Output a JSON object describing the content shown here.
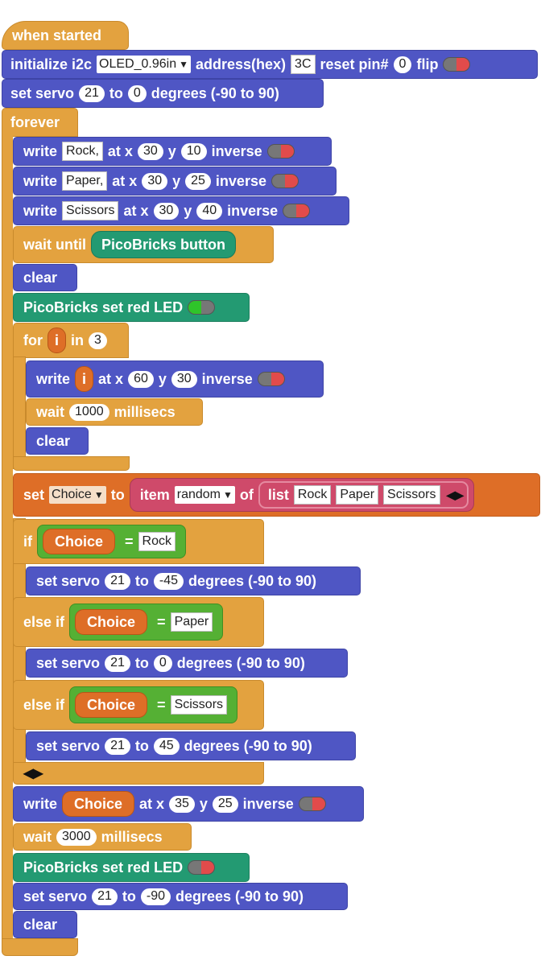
{
  "hat": {
    "label": "when started"
  },
  "init_i2c": {
    "label": "initialize i2c",
    "display": "OLED_0.96in",
    "address_label": "address(hex)",
    "address": "3C",
    "reset_label": "reset pin#",
    "reset_pin": "0",
    "flip_label": "flip"
  },
  "servo_init": {
    "set": "set servo",
    "pin": "21",
    "to": "to",
    "angle": "0",
    "degrees": "degrees (-90 to 90)"
  },
  "forever": {
    "label": "forever"
  },
  "writes": [
    {
      "write": "write",
      "text": "Rock,",
      "at_x": "at x",
      "x": "30",
      "y_label": "y",
      "y": "10",
      "inverse": "inverse"
    },
    {
      "write": "write",
      "text": "Paper,",
      "at_x": "at x",
      "x": "30",
      "y_label": "y",
      "y": "25",
      "inverse": "inverse"
    },
    {
      "write": "write",
      "text": "Scissors",
      "at_x": "at x",
      "x": "30",
      "y_label": "y",
      "y": "40",
      "inverse": "inverse"
    }
  ],
  "wait_until": {
    "label": "wait until",
    "condition": "PicoBricks button"
  },
  "clear_label": "clear",
  "led_on": {
    "label": "PicoBricks set red LED"
  },
  "for_loop": {
    "for": "for",
    "var": "i",
    "in": "in",
    "count": "3"
  },
  "write_i": {
    "write": "write",
    "var": "i",
    "at_x": "at x",
    "x": "60",
    "y_label": "y",
    "y": "30",
    "inverse": "inverse"
  },
  "wait_1000": {
    "wait": "wait",
    "ms": "1000",
    "unit": "millisecs"
  },
  "set_choice": {
    "set": "set",
    "var": "Choice",
    "to": "to",
    "item": "item",
    "mode": "random",
    "of": "of",
    "list": "list",
    "items": [
      "Rock",
      "Paper",
      "Scissors"
    ]
  },
  "if_branches": [
    {
      "kw": "if",
      "var": "Choice",
      "eq": "=",
      "value": "Rock",
      "servo": {
        "set": "set servo",
        "pin": "21",
        "to": "to",
        "angle": "-45",
        "degrees": "degrees (-90 to 90)"
      }
    },
    {
      "kw": "else if",
      "var": "Choice",
      "eq": "=",
      "value": "Paper",
      "servo": {
        "set": "set servo",
        "pin": "21",
        "to": "to",
        "angle": "0",
        "degrees": "degrees (-90 to 90)"
      }
    },
    {
      "kw": "else if",
      "var": "Choice",
      "eq": "=",
      "value": "Scissors",
      "servo": {
        "set": "set servo",
        "pin": "21",
        "to": "to",
        "angle": "45",
        "degrees": "degrees (-90 to 90)"
      }
    }
  ],
  "write_choice": {
    "write": "write",
    "var": "Choice",
    "at_x": "at x",
    "x": "35",
    "y_label": "y",
    "y": "25",
    "inverse": "inverse"
  },
  "wait_3000": {
    "wait": "wait",
    "ms": "3000",
    "unit": "millisecs"
  },
  "led_off": {
    "label": "PicoBricks set red LED"
  },
  "servo_end": {
    "set": "set servo",
    "pin": "21",
    "to": "to",
    "angle": "-90",
    "degrees": "degrees (-90 to 90)"
  },
  "colors": {
    "motion": "#4f56c4",
    "control": "#e3a23f",
    "picobricks": "#239a72",
    "variable": "#de6e27",
    "logic": "#55b034",
    "list": "#cf4a6a"
  }
}
